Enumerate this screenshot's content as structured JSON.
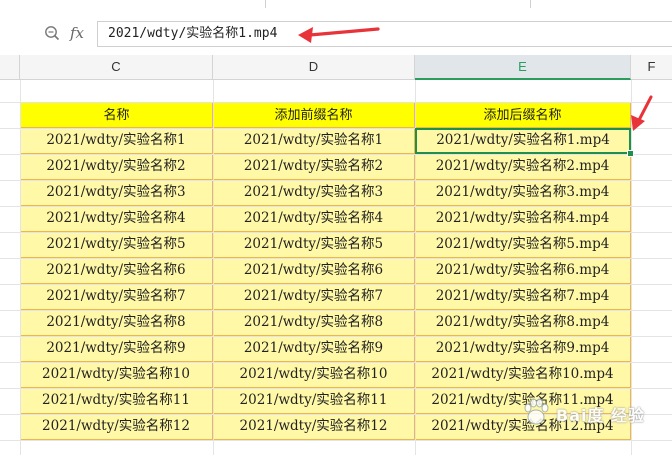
{
  "formula_bar": {
    "zoom_icon": "zoom-lookup-icon",
    "fx_label": "fx",
    "value": "2021/wdty/实验名称1.mp4"
  },
  "columns": [
    {
      "id": "C",
      "label": "C"
    },
    {
      "id": "D",
      "label": "D"
    },
    {
      "id": "E",
      "label": "E",
      "selected": true
    },
    {
      "id": "F",
      "label": "F"
    }
  ],
  "table": {
    "headers": [
      "名称",
      "添加前缀名称",
      "添加后缀名称"
    ],
    "rows": [
      [
        "2021/wdty/实验名称1",
        "2021/wdty/实验名称1",
        "2021/wdty/实验名称1.mp4"
      ],
      [
        "2021/wdty/实验名称2",
        "2021/wdty/实验名称2",
        "2021/wdty/实验名称2.mp4"
      ],
      [
        "2021/wdty/实验名称3",
        "2021/wdty/实验名称3",
        "2021/wdty/实验名称3.mp4"
      ],
      [
        "2021/wdty/实验名称4",
        "2021/wdty/实验名称4",
        "2021/wdty/实验名称4.mp4"
      ],
      [
        "2021/wdty/实验名称5",
        "2021/wdty/实验名称5",
        "2021/wdty/实验名称5.mp4"
      ],
      [
        "2021/wdty/实验名称6",
        "2021/wdty/实验名称6",
        "2021/wdty/实验名称6.mp4"
      ],
      [
        "2021/wdty/实验名称7",
        "2021/wdty/实验名称7",
        "2021/wdty/实验名称7.mp4"
      ],
      [
        "2021/wdty/实验名称8",
        "2021/wdty/实验名称8",
        "2021/wdty/实验名称8.mp4"
      ],
      [
        "2021/wdty/实验名称9",
        "2021/wdty/实验名称9",
        "2021/wdty/实验名称9.mp4"
      ],
      [
        "2021/wdty/实验名称10",
        "2021/wdty/实验名称10",
        "2021/wdty/实验名称10.mp4"
      ],
      [
        "2021/wdty/实验名称11",
        "2021/wdty/实验名称11",
        "2021/wdty/实验名称11.mp4"
      ],
      [
        "2021/wdty/实验名称12",
        "2021/wdty/实验名称12",
        "2021/wdty/实验名称12.mp4"
      ]
    ],
    "selected_cell": {
      "row": 0,
      "col": 2
    }
  },
  "colors": {
    "header_fill": "#ffff00",
    "cell_fill": "#fff8a6",
    "cell_border": "#f1b64a",
    "selection": "#1f8f4e",
    "annotation_arrow": "#e8333a"
  },
  "watermark": {
    "text": "Bai度 经验",
    "icon": "baidu-paw-icon"
  }
}
